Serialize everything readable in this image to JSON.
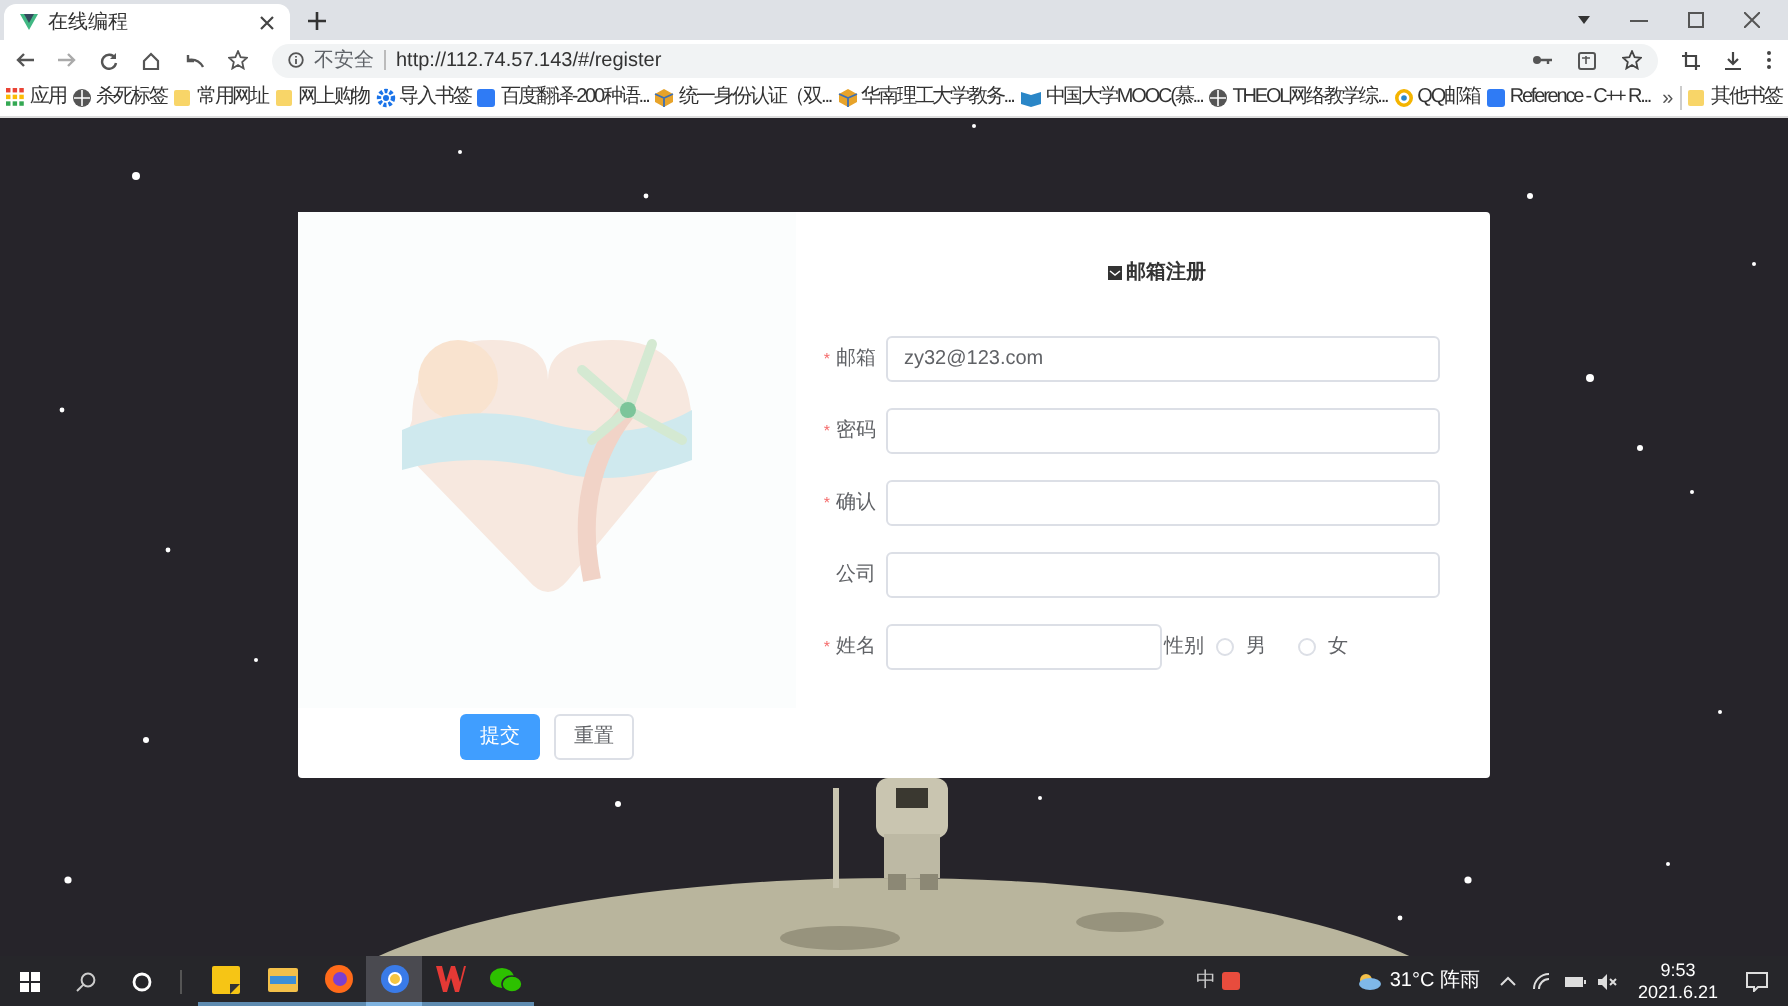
{
  "browser": {
    "tab_title": "在线编程",
    "security": "不安全",
    "url": "http://112.74.57.143/#/register",
    "bookmarks": [
      {
        "label": "应用",
        "kind": "grid"
      },
      {
        "label": "杀死标签",
        "kind": "globe"
      },
      {
        "label": "常用网址",
        "kind": "folder"
      },
      {
        "label": "网上购物",
        "kind": "folder"
      },
      {
        "label": "导入书签",
        "kind": "gear"
      },
      {
        "label": "百度翻译-200种语...",
        "kind": "square"
      },
      {
        "label": "统一身份认证（双...",
        "kind": "cube"
      },
      {
        "label": "华南理工大学教务...",
        "kind": "cube"
      },
      {
        "label": "中国大学MOOC(慕...",
        "kind": "book"
      },
      {
        "label": "THEOL网络教学综...",
        "kind": "globe"
      },
      {
        "label": "QQ邮箱",
        "kind": "ring"
      },
      {
        "label": "Reference - C++ R...",
        "kind": "square"
      }
    ],
    "more": "»",
    "other_bookmarks": "其他书签"
  },
  "form": {
    "title": "邮箱注册",
    "required_mark": "*",
    "fields": [
      {
        "label": "邮箱",
        "required": true,
        "value": "zy32@123.com"
      },
      {
        "label": "密码",
        "required": true
      },
      {
        "label": "确认",
        "required": true
      },
      {
        "label": "公司",
        "required": false
      },
      {
        "label": "姓名",
        "required": true,
        "kind": "name"
      }
    ],
    "gender_label": "性别",
    "gender_options": [
      {
        "label": "男",
        "selected": false
      },
      {
        "label": "女",
        "selected": false
      }
    ],
    "buttons": [
      {
        "label": "提交",
        "kind": "primary"
      },
      {
        "label": "重置",
        "kind": "default"
      }
    ]
  },
  "taskbar": {
    "apps": [
      {
        "kind": "notes",
        "selected": false
      },
      {
        "kind": "files",
        "selected": false
      },
      {
        "kind": "firefox",
        "selected": false
      },
      {
        "kind": "chrome",
        "selected": true
      },
      {
        "kind": "wps",
        "selected": false
      },
      {
        "kind": "wechat",
        "selected": false
      }
    ],
    "ime": "中",
    "weather": "31°C 阵雨",
    "time": "9:53",
    "date": "2021.6.21"
  }
}
